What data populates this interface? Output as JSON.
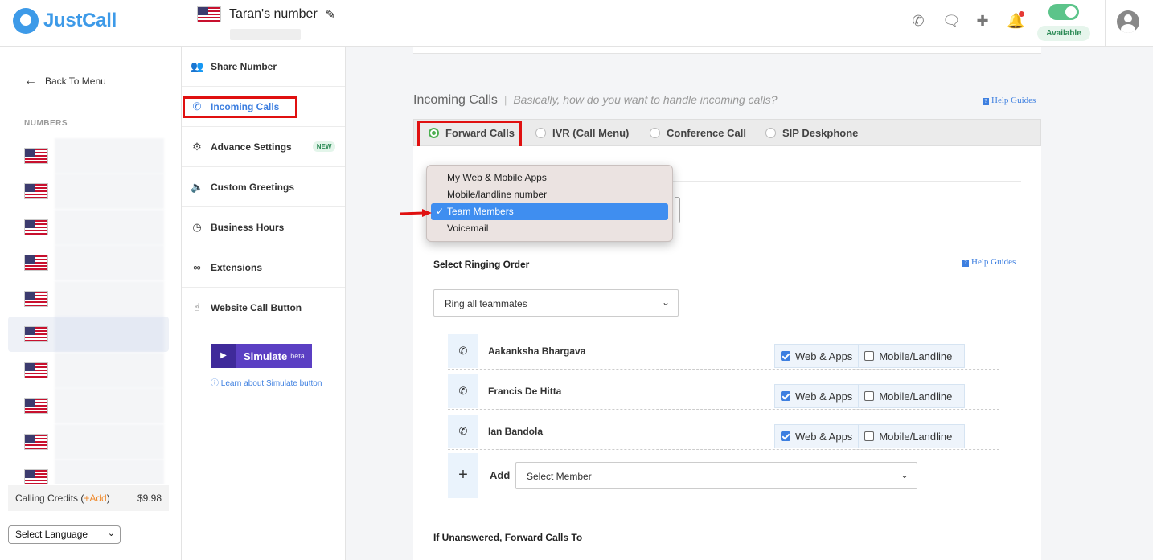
{
  "topbar": {
    "logo_text": "JustCall",
    "number_title": "Taran's number",
    "status_label": "Available",
    "icons": [
      "phone-icon",
      "chat-icon",
      "apps-icon",
      "bell-icon",
      "user-icon"
    ]
  },
  "sidebar": {
    "back_label": "Back To Menu",
    "numbers_label": "NUMBERS",
    "credits_label": "Calling Credits (",
    "credits_add": "+Add",
    "credits_close": ")",
    "credits_amount": "$9.98",
    "language": "Select Language"
  },
  "submenu": {
    "items": [
      {
        "label": "Share Number",
        "icon": "users-icon"
      },
      {
        "label": "Incoming Calls",
        "icon": "phone-icon"
      },
      {
        "label": "Advance Settings",
        "icon": "gear-icon",
        "badge": "NEW"
      },
      {
        "label": "Custom Greetings",
        "icon": "speaker-icon"
      },
      {
        "label": "Business Hours",
        "icon": "clock-icon"
      },
      {
        "label": "Extensions",
        "icon": "link-icon"
      },
      {
        "label": "Website Call Button",
        "icon": "pointer-icon"
      }
    ],
    "simulate_label": "Simulate",
    "simulate_badge": "beta",
    "learn_link": "Learn about Simulate button"
  },
  "main": {
    "section_title": "Incoming Calls",
    "section_sep": "|",
    "section_subtitle": "Basically, how do you want to handle incoming calls?",
    "help_label": "Help Guides",
    "tabs": [
      {
        "label": "Forward Calls",
        "checked": true
      },
      {
        "label": "IVR (Call Menu)",
        "checked": false
      },
      {
        "label": "Conference Call",
        "checked": false
      },
      {
        "label": "SIP Deskphone",
        "checked": false
      }
    ],
    "forward_dropdown": {
      "options": [
        "My Web & Mobile Apps",
        "Mobile/landline number",
        "Team Members",
        "Voicemail"
      ],
      "selected": "Team Members"
    },
    "ringing_order_title": "Select Ringing Order",
    "ringing_order_value": "Ring all teammates",
    "members": [
      {
        "name": "Aakanksha Bhargava",
        "web_apps": true,
        "mobile_landline": false
      },
      {
        "name": "Francis De Hitta",
        "web_apps": true,
        "mobile_landline": false
      },
      {
        "name": "Ian Bandola",
        "web_apps": true,
        "mobile_landline": false
      }
    ],
    "web_apps_label": "Web & Apps",
    "mobile_landline_label": "Mobile/Landline",
    "add_label": "Add",
    "select_member_placeholder": "Select Member",
    "unanswered_title": "If Unanswered, Forward Calls To"
  }
}
